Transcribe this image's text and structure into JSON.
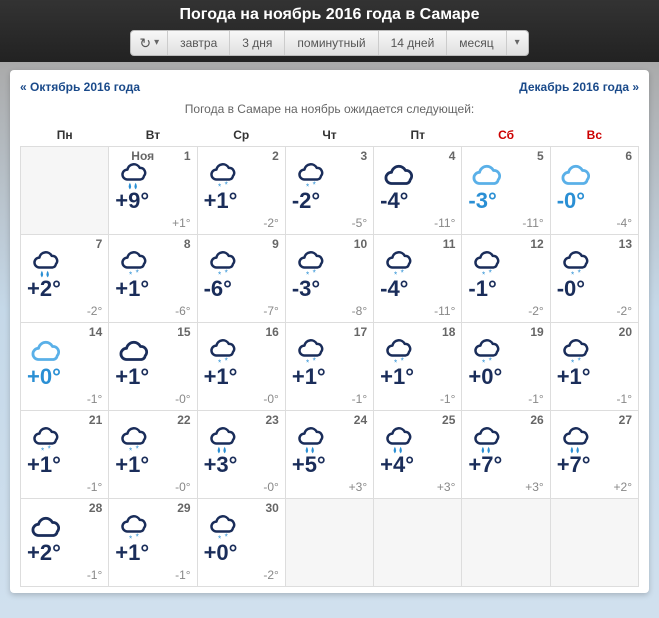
{
  "title": "Погода на ноябрь 2016 года в Самаре",
  "tabs": {
    "tomorrow": "завтра",
    "days3": "3 дня",
    "minute": "поминутный",
    "days14": "14 дней",
    "month": "месяц"
  },
  "nav": {
    "prev": "« Октябрь 2016 года",
    "next": "Декабрь 2016 года »"
  },
  "subtitle": "Погода в Самаре на ноябрь ожидается следующей:",
  "weekdays": [
    "Пн",
    "Вт",
    "Ср",
    "Чт",
    "Пт",
    "Сб",
    "Вс"
  ],
  "monthLabel": "Ноя",
  "days": [
    {
      "n": 1,
      "hi": "+9°",
      "lo": "+1°",
      "icon": "rain",
      "blue": false
    },
    {
      "n": 2,
      "hi": "+1°",
      "lo": "-2°",
      "icon": "snow",
      "blue": false
    },
    {
      "n": 3,
      "hi": "-2°",
      "lo": "-5°",
      "icon": "snow",
      "blue": false
    },
    {
      "n": 4,
      "hi": "-4°",
      "lo": "-11°",
      "icon": "cloud",
      "blue": false
    },
    {
      "n": 5,
      "hi": "-3°",
      "lo": "-11°",
      "icon": "cloud-light",
      "blue": true
    },
    {
      "n": 6,
      "hi": "-0°",
      "lo": "-4°",
      "icon": "cloud-light",
      "blue": true
    },
    {
      "n": 7,
      "hi": "+2°",
      "lo": "-2°",
      "icon": "rain",
      "blue": false
    },
    {
      "n": 8,
      "hi": "+1°",
      "lo": "-6°",
      "icon": "snow",
      "blue": false
    },
    {
      "n": 9,
      "hi": "-6°",
      "lo": "-7°",
      "icon": "snow",
      "blue": false
    },
    {
      "n": 10,
      "hi": "-3°",
      "lo": "-8°",
      "icon": "snow",
      "blue": false
    },
    {
      "n": 11,
      "hi": "-4°",
      "lo": "-11°",
      "icon": "snow",
      "blue": false
    },
    {
      "n": 12,
      "hi": "-1°",
      "lo": "-2°",
      "icon": "snow",
      "blue": false
    },
    {
      "n": 13,
      "hi": "-0°",
      "lo": "-2°",
      "icon": "snow",
      "blue": false
    },
    {
      "n": 14,
      "hi": "+0°",
      "lo": "-1°",
      "icon": "cloud-light",
      "blue": true
    },
    {
      "n": 15,
      "hi": "+1°",
      "lo": "-0°",
      "icon": "cloud",
      "blue": false
    },
    {
      "n": 16,
      "hi": "+1°",
      "lo": "-0°",
      "icon": "snow",
      "blue": false
    },
    {
      "n": 17,
      "hi": "+1°",
      "lo": "-1°",
      "icon": "snow",
      "blue": false
    },
    {
      "n": 18,
      "hi": "+1°",
      "lo": "-1°",
      "icon": "snow",
      "blue": false
    },
    {
      "n": 19,
      "hi": "+0°",
      "lo": "-1°",
      "icon": "snow",
      "blue": false
    },
    {
      "n": 20,
      "hi": "+1°",
      "lo": "-1°",
      "icon": "snow",
      "blue": false
    },
    {
      "n": 21,
      "hi": "+1°",
      "lo": "-1°",
      "icon": "snow",
      "blue": false
    },
    {
      "n": 22,
      "hi": "+1°",
      "lo": "-0°",
      "icon": "snow",
      "blue": false
    },
    {
      "n": 23,
      "hi": "+3°",
      "lo": "-0°",
      "icon": "rain",
      "blue": false
    },
    {
      "n": 24,
      "hi": "+5°",
      "lo": "+3°",
      "icon": "rain",
      "blue": false
    },
    {
      "n": 25,
      "hi": "+4°",
      "lo": "+3°",
      "icon": "rain",
      "blue": false
    },
    {
      "n": 26,
      "hi": "+7°",
      "lo": "+3°",
      "icon": "rain",
      "blue": false
    },
    {
      "n": 27,
      "hi": "+7°",
      "lo": "+2°",
      "icon": "rain",
      "blue": false
    },
    {
      "n": 28,
      "hi": "+2°",
      "lo": "-1°",
      "icon": "cloud",
      "blue": false
    },
    {
      "n": 29,
      "hi": "+1°",
      "lo": "-1°",
      "icon": "snow",
      "blue": false
    },
    {
      "n": 30,
      "hi": "+0°",
      "lo": "-2°",
      "icon": "snow",
      "blue": false
    }
  ]
}
